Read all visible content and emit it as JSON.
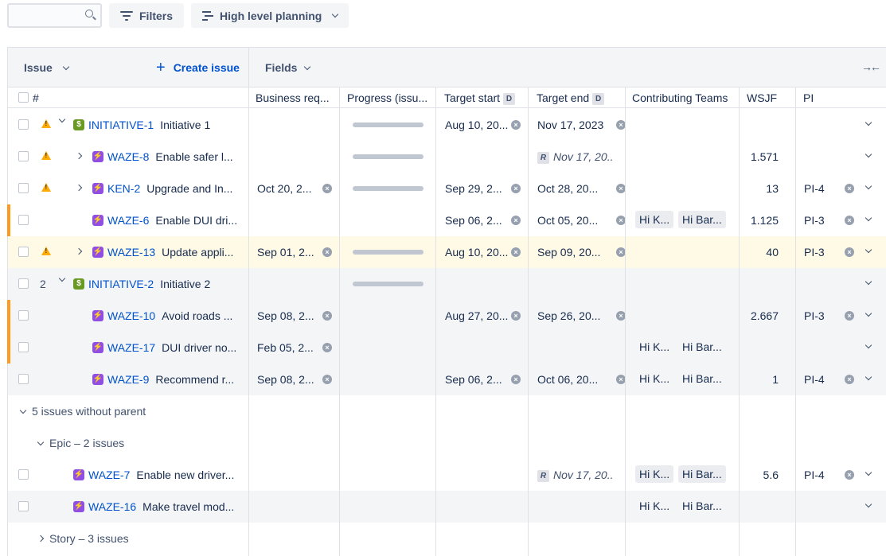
{
  "toolbar": {
    "search_placeholder": "",
    "filters_label": "Filters",
    "planning_label": "High level planning"
  },
  "header": {
    "issue_label": "Issue",
    "create_label": "Create issue",
    "fields_label": "Fields"
  },
  "columns": {
    "hash": "#",
    "business": "Business req...",
    "progress": "Progress (issu...",
    "target_start": "Target start",
    "target_end": "Target end",
    "date_badge": "D",
    "teams": "Contributing Teams",
    "wsjf": "WSJF",
    "pi": "PI"
  },
  "rows": [
    {
      "key": "INITIATIVE-1",
      "title": "Initiative 1",
      "type": "initiative",
      "warn": true,
      "twisty": "down",
      "indent": 0,
      "business": "",
      "progress": true,
      "start": "Aug 10, 20...",
      "end": "Nov 17, 2023",
      "end_rollup": false,
      "teams": [],
      "wsjf": "",
      "pi": "",
      "bg": "white",
      "flag": false
    },
    {
      "key": "WAZE-8",
      "title": "Enable safer l...",
      "type": "epic",
      "warn": true,
      "twisty": "right",
      "indent": 1,
      "business": "",
      "progress": true,
      "start": "",
      "end": "Nov 17, 20...",
      "end_rollup": true,
      "teams": [],
      "wsjf": "1.571",
      "pi": "",
      "bg": "white",
      "flag": false
    },
    {
      "key": "KEN-2",
      "title": "Upgrade and In...",
      "type": "epic",
      "warn": true,
      "twisty": "right",
      "indent": 1,
      "business": "Oct 20, 2...",
      "progress": true,
      "start": "Sep 29, 2...",
      "end": "Oct 28, 20...",
      "end_rollup": false,
      "teams": [],
      "wsjf": "13",
      "pi": "PI-4",
      "bg": "white",
      "flag": false
    },
    {
      "key": "WAZE-6",
      "title": "Enable DUI dri...",
      "type": "epic",
      "warn": false,
      "twisty": "",
      "indent": 1,
      "business": "",
      "progress": false,
      "start": "Sep 06, 2...",
      "end": "Oct 05, 20...",
      "end_rollup": false,
      "teams": [
        "Hi K...",
        "Hi Bar..."
      ],
      "teams_bg": true,
      "wsjf": "1.125",
      "pi": "PI-3",
      "bg": "white",
      "flag": true
    },
    {
      "key": "WAZE-13",
      "title": "Update appli...",
      "type": "epic",
      "warn": true,
      "twisty": "right",
      "indent": 1,
      "business": "Sep 01, 2...",
      "progress": true,
      "start": "Aug 10, 20...",
      "end": "Sep 09, 20...",
      "end_rollup": false,
      "teams": [],
      "wsjf": "40",
      "pi": "PI-3",
      "bg": "yellow",
      "flag": false
    },
    {
      "key": "INITIATIVE-2",
      "title": "Initiative 2",
      "type": "initiative",
      "warn": false,
      "count": "2",
      "twisty": "down",
      "indent": 0,
      "business": "",
      "progress": true,
      "start": "",
      "end": "",
      "end_rollup": false,
      "teams": [],
      "wsjf": "",
      "pi": "",
      "bg": "grey",
      "flag": false
    },
    {
      "key": "WAZE-10",
      "title": "Avoid roads ...",
      "type": "epic",
      "warn": false,
      "twisty": "",
      "indent": 1,
      "business": "Sep 08, 2...",
      "progress": false,
      "start": "Aug 27, 20...",
      "end": "Sep 26, 20...",
      "end_rollup": false,
      "teams": [],
      "wsjf": "2.667",
      "pi": "PI-3",
      "bg": "grey",
      "flag": true
    },
    {
      "key": "WAZE-17",
      "title": "DUI driver no...",
      "type": "epic",
      "warn": false,
      "twisty": "",
      "indent": 1,
      "business": "Feb 05, 2...",
      "progress": false,
      "start": "",
      "end": "",
      "end_rollup": false,
      "teams": [
        "Hi K...",
        "Hi Bar..."
      ],
      "teams_bg": false,
      "wsjf": "",
      "pi": "",
      "bg": "grey",
      "flag": true
    },
    {
      "key": "WAZE-9",
      "title": "Recommend r...",
      "type": "epic",
      "warn": false,
      "twisty": "",
      "indent": 1,
      "business": "Sep 08, 2...",
      "progress": false,
      "start": "Sep 06, 2...",
      "end": "Oct 06, 20...",
      "end_rollup": false,
      "teams": [
        "Hi K...",
        "Hi Bar..."
      ],
      "teams_bg": false,
      "wsjf": "1",
      "pi": "PI-4",
      "bg": "grey",
      "flag": false
    }
  ],
  "groups": {
    "no_parent": "5 issues without parent",
    "epic_group": "Epic – 2 issues",
    "story_group": "Story – 3 issues"
  },
  "rows2": [
    {
      "key": "WAZE-7",
      "title": "Enable new driver...",
      "end": "Nov 17, 20...",
      "end_rollup": true,
      "teams": [
        "Hi K...",
        "Hi Bar..."
      ],
      "teams_bg": true,
      "wsjf": "5.6",
      "pi": "PI-4",
      "bg": "white"
    },
    {
      "key": "WAZE-16",
      "title": "Make travel mod...",
      "end": "",
      "end_rollup": false,
      "teams": [
        "Hi K...",
        "Hi Bar..."
      ],
      "teams_bg": false,
      "wsjf": "",
      "pi": "",
      "bg": "grey"
    }
  ],
  "icons": {
    "rollup_badge": "R",
    "clear_glyph": "×",
    "initiative_glyph": "$",
    "epic_glyph": "⚡"
  }
}
